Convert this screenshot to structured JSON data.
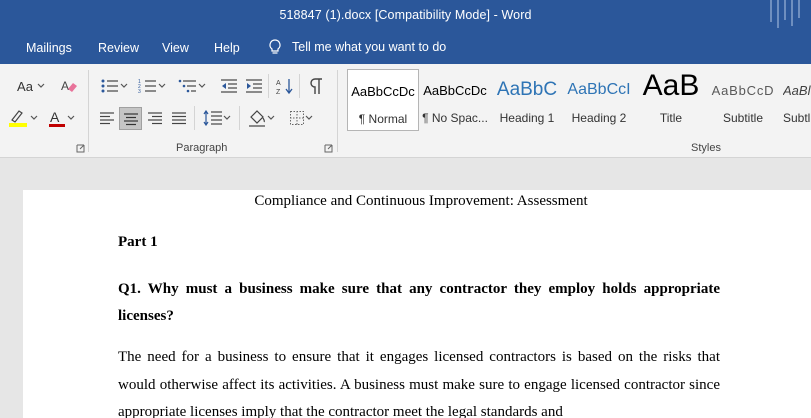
{
  "window": {
    "title": "518847 (1).docx [Compatibility Mode]  -  Word"
  },
  "tabs": [
    {
      "label": "Mailings"
    },
    {
      "label": "Review"
    },
    {
      "label": "View"
    },
    {
      "label": "Help"
    }
  ],
  "tell_me": {
    "label": "Tell me what you want to do",
    "icon": "lightbulb-icon"
  },
  "ribbon": {
    "font_group": {
      "change_case": "Aa"
    },
    "paragraph_group": {
      "label": "Paragraph"
    },
    "styles_group": {
      "label": "Styles",
      "items": [
        {
          "preview": "AaBbCcDc",
          "name": "¶ Normal",
          "selected": true
        },
        {
          "preview": "AaBbCcDc",
          "name": "¶ No Spac..."
        },
        {
          "preview": "AaBbC",
          "name": "Heading 1"
        },
        {
          "preview": "AaBbCcI",
          "name": "Heading 2"
        },
        {
          "preview": "AaB",
          "name": "Title"
        },
        {
          "preview": "AaBbCcD",
          "name": "Subtitle"
        },
        {
          "preview": "AaBl",
          "name": "Subtl"
        }
      ]
    }
  },
  "colors": {
    "brand": "#2b579a",
    "font_color": "#c00000",
    "highlight": "#ffff00",
    "heading": "#2e74b5"
  },
  "document": {
    "title": "Compliance and Continuous Improvement: Assessment",
    "part": "Part 1",
    "question": "Q1. Why must a business make sure that any contractor they employ holds appropriate licenses?",
    "paragraph": "The need for a business to ensure that it engages licensed contractors is based on the risks that would otherwise affect its activities. A business must make sure to engage licensed contractor since appropriate licenses imply that the contractor meet the legal standards and"
  }
}
